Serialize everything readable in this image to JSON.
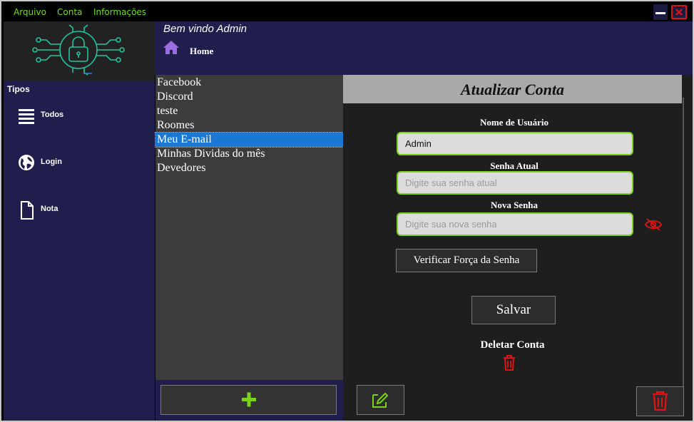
{
  "menu": {
    "items": [
      "Arquivo",
      "Conta",
      "Informações"
    ]
  },
  "header": {
    "welcome": "Bem vindo Admin",
    "home_label": "Home"
  },
  "sidebar": {
    "title": "Tipos",
    "items": [
      {
        "label": "Todos",
        "icon": "list-icon"
      },
      {
        "label": "Login",
        "icon": "globe-icon"
      },
      {
        "label": "Nota",
        "icon": "document-icon"
      }
    ]
  },
  "accounts": {
    "items": [
      "Facebook",
      "Discord",
      "teste",
      "Roomes",
      "Meu E-mail",
      "Minhas Dividas do mês",
      "Devedores"
    ],
    "selected": "Meu E-mail"
  },
  "form": {
    "title": "Atualizar Conta",
    "username_label": "Nome de Usuário",
    "username_value": "Admin",
    "current_password_label": "Senha Atual",
    "current_password_placeholder": "Digite sua senha atual",
    "new_password_label": "Nova Senha",
    "new_password_placeholder": "Digite sua nova senha",
    "verify_button": "Verificar Força da Senha",
    "save_button": "Salvar",
    "delete_label": "Deletar Conta"
  },
  "colors": {
    "accent_green": "#7cd21a",
    "danger_red": "#e01414",
    "navy": "#1f1e4c",
    "selection_blue": "#1a78d4"
  }
}
